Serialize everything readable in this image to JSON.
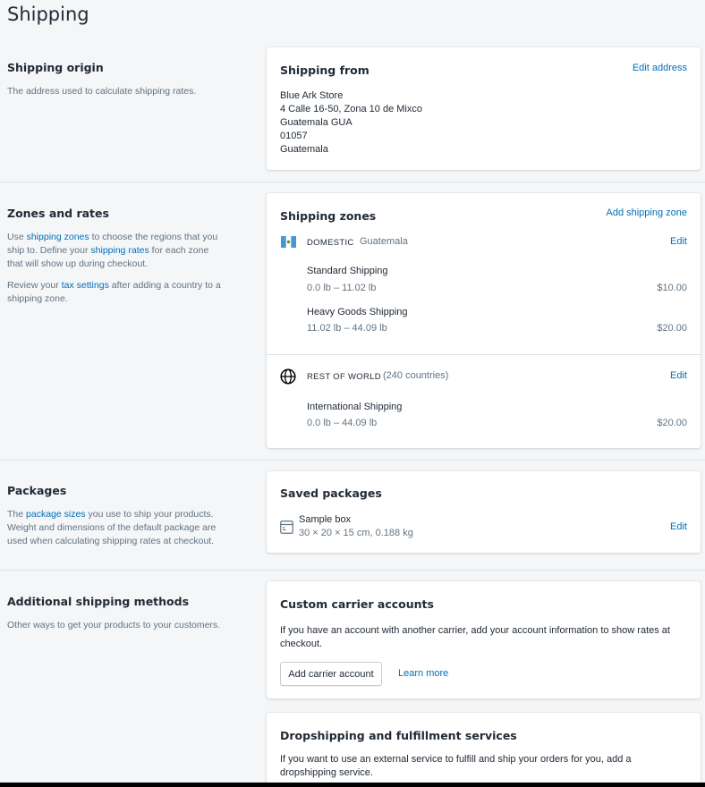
{
  "page": {
    "title": "Shipping"
  },
  "origin": {
    "heading": "Shipping origin",
    "description": "The address used to calculate shipping rates.",
    "card_title": "Shipping from",
    "edit_label": "Edit address",
    "address_lines": [
      "Blue Ark Store",
      "4 Calle 16-50, Zona 10 de Mixco",
      "Guatemala GUA",
      "01057",
      "Guatemala"
    ]
  },
  "zones": {
    "heading": "Zones and rates",
    "desc_p1_a": "Use ",
    "desc_link1": "shipping zones",
    "desc_p1_b": " to choose the regions that you ship to. Define your ",
    "desc_link2": "shipping rates",
    "desc_p1_c": " for each zone that will show up during checkout.",
    "desc_p2_a": "Review your ",
    "desc_link3": "tax settings",
    "desc_p2_b": " after adding a country to a shipping zone.",
    "card_title": "Shipping zones",
    "add_label": "Add shipping zone",
    "domestic": {
      "label": "DOMESTIC",
      "country": "Guatemala",
      "edit_label": "Edit",
      "rates": [
        {
          "name": "Standard Shipping",
          "range": "0.0 lb – 11.02 lb",
          "price": "$10.00"
        },
        {
          "name": "Heavy Goods Shipping",
          "range": "11.02 lb – 44.09 lb",
          "price": "$20.00"
        }
      ]
    },
    "world": {
      "label": "REST OF WORLD",
      "count": "(240 countries)",
      "edit_label": "Edit",
      "rates": [
        {
          "name": "International Shipping",
          "range": "0.0 lb – 44.09 lb",
          "price": "$20.00"
        }
      ]
    }
  },
  "packages": {
    "heading": "Packages",
    "desc_a": "The ",
    "desc_link": "package sizes",
    "desc_b": " you use to ship your products. Weight and dimensions of the default package are used when calculating shipping rates at checkout.",
    "card_title": "Saved packages",
    "item_name": "Sample box",
    "item_dims": "30 × 20 × 15 cm, 0.188 kg",
    "edit_label": "Edit"
  },
  "additional": {
    "heading": "Additional shipping methods",
    "description": "Other ways to get your products to your customers.",
    "carrier": {
      "card_title": "Custom carrier accounts",
      "text": "If you have an account with another carrier, add your account information to show rates at checkout.",
      "button_label": "Add carrier account",
      "learn_more": "Learn more"
    },
    "dropship": {
      "card_title": "Dropshipping and fulfillment services",
      "text": "If you want to use an external service to fulfill and ship your orders for you, add a dropshipping service."
    }
  },
  "colors": {
    "link": "#006fbb",
    "background": "#f4f6f8",
    "text": "#212b36",
    "subdued": "#637381"
  }
}
